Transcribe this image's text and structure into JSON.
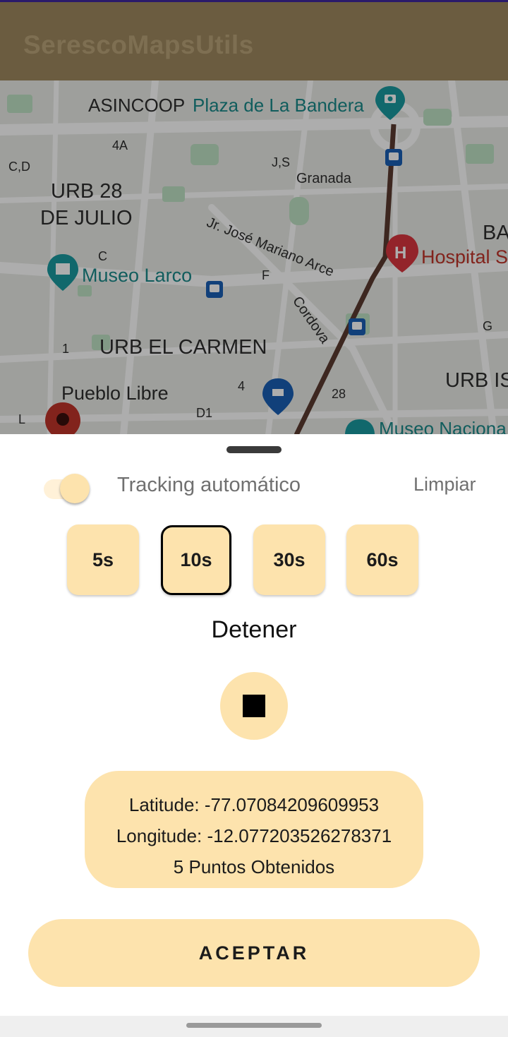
{
  "app": {
    "title": "SerescoMapsUtils"
  },
  "map": {
    "labels": {
      "asincoop": "ASINCOOP",
      "plaza": "Plaza de La Bandera",
      "l4a": "4A",
      "cd": "C,D",
      "js": "J,S",
      "granada": "Granada",
      "urb28a": "URB 28",
      "urb28b": "DE JULIO",
      "arce": "Jr. José Mariano Arce",
      "ba": "BA",
      "hospital": "Hospital S",
      "c": "C",
      "museo_larco": "Museo Larco",
      "f": "F",
      "cordova": "Cordova",
      "g": "G",
      "one": "1",
      "urb_carmen": "URB EL CARMEN",
      "urb_is": "URB IS",
      "pueblo_libre": "Pueblo Libre",
      "four": "4",
      "twenty_eight": "28",
      "l": "L",
      "d1": "D1",
      "museo_nacional": "Museo Naciona"
    },
    "colors": {
      "route": "#5a3a30",
      "poi_teal": "#1a9aa0",
      "transit_blue": "#1a5fb4",
      "hospital_red": "#d9363e"
    }
  },
  "sheet": {
    "tracking_label": "Tracking automático",
    "tracking_enabled": true,
    "clear_label": "Limpiar",
    "intervals": [
      "5s",
      "10s",
      "30s",
      "60s"
    ],
    "selected_interval": "10s",
    "status_label": "Detener",
    "stop_icon": "stop-icon",
    "coords": {
      "latitude": "Latitude: -77.07084209609953",
      "longitude": "Longitude: -12.077203526278371",
      "points": "5 Puntos Obtenidos"
    },
    "accept_label": "ACEPTAR"
  },
  "colors": {
    "accent": "#fde3ad",
    "app_bar": "#6b5c40"
  }
}
